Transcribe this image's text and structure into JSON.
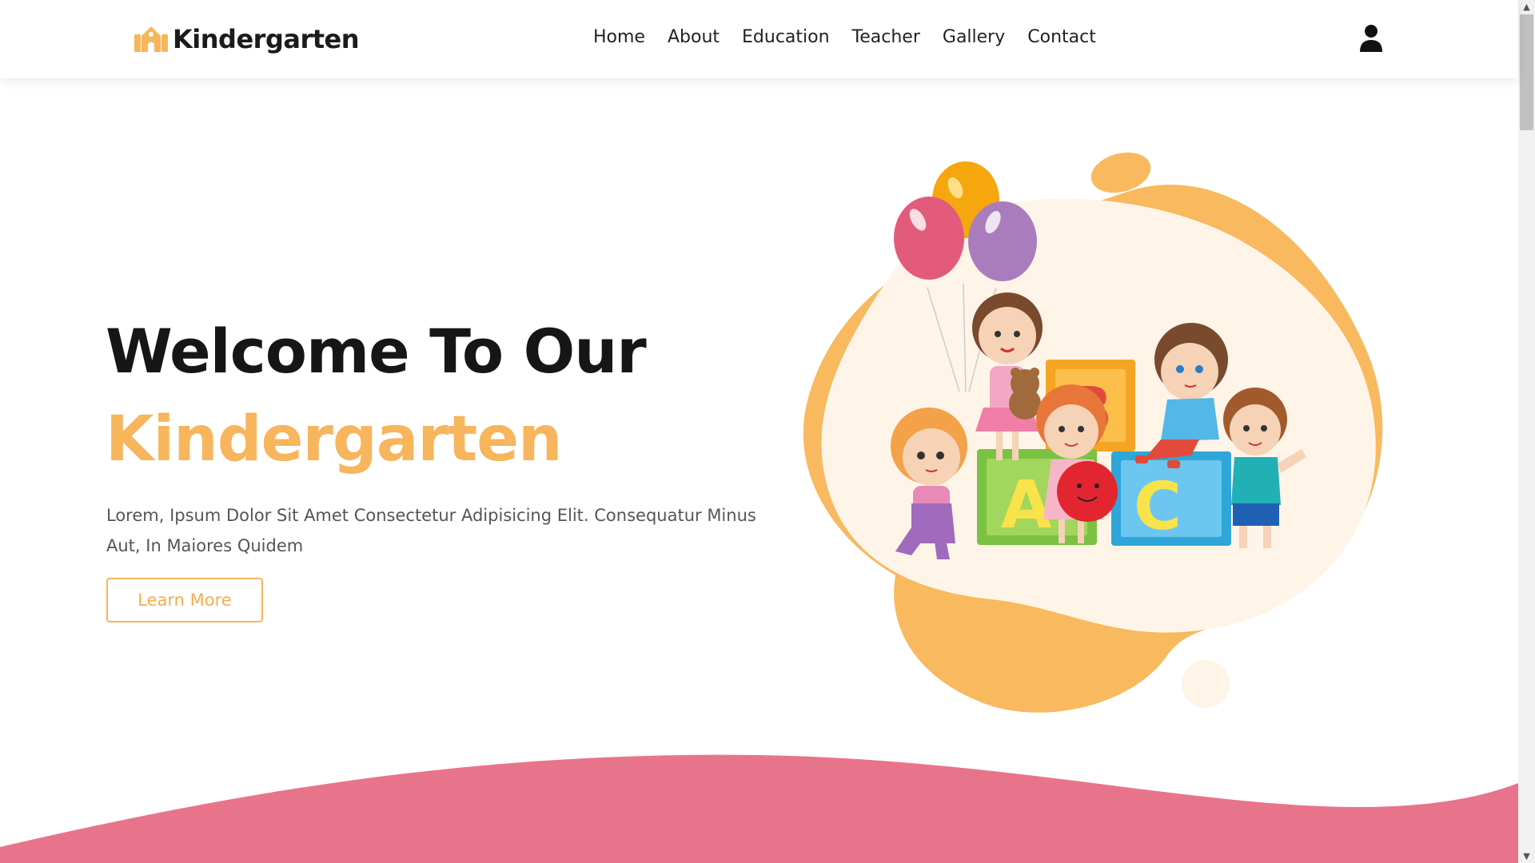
{
  "brand": {
    "name": "Kindergarten",
    "icon": "school-building-icon",
    "color": "#f7b55c"
  },
  "nav": {
    "items": [
      {
        "label": "Home"
      },
      {
        "label": "About"
      },
      {
        "label": "Education"
      },
      {
        "label": "Teacher"
      },
      {
        "label": "Gallery"
      },
      {
        "label": "Contact"
      }
    ],
    "account_icon": "user-icon"
  },
  "hero": {
    "title": "Welcome To Our",
    "accent": "Kindergarten",
    "description": "Lorem, Ipsum Dolor Sit Amet Consectetur Adipisicing Elit. Consequatur Minus Aut, In Maiores Quidem",
    "button_label": "Learn More",
    "illustration": "kids-with-balloons-and-abc-blocks-illustration"
  },
  "colors": {
    "accent": "#f7b55c",
    "blob_light": "#fef4e8",
    "wave": "#e8748c",
    "text_dark": "#161616"
  }
}
